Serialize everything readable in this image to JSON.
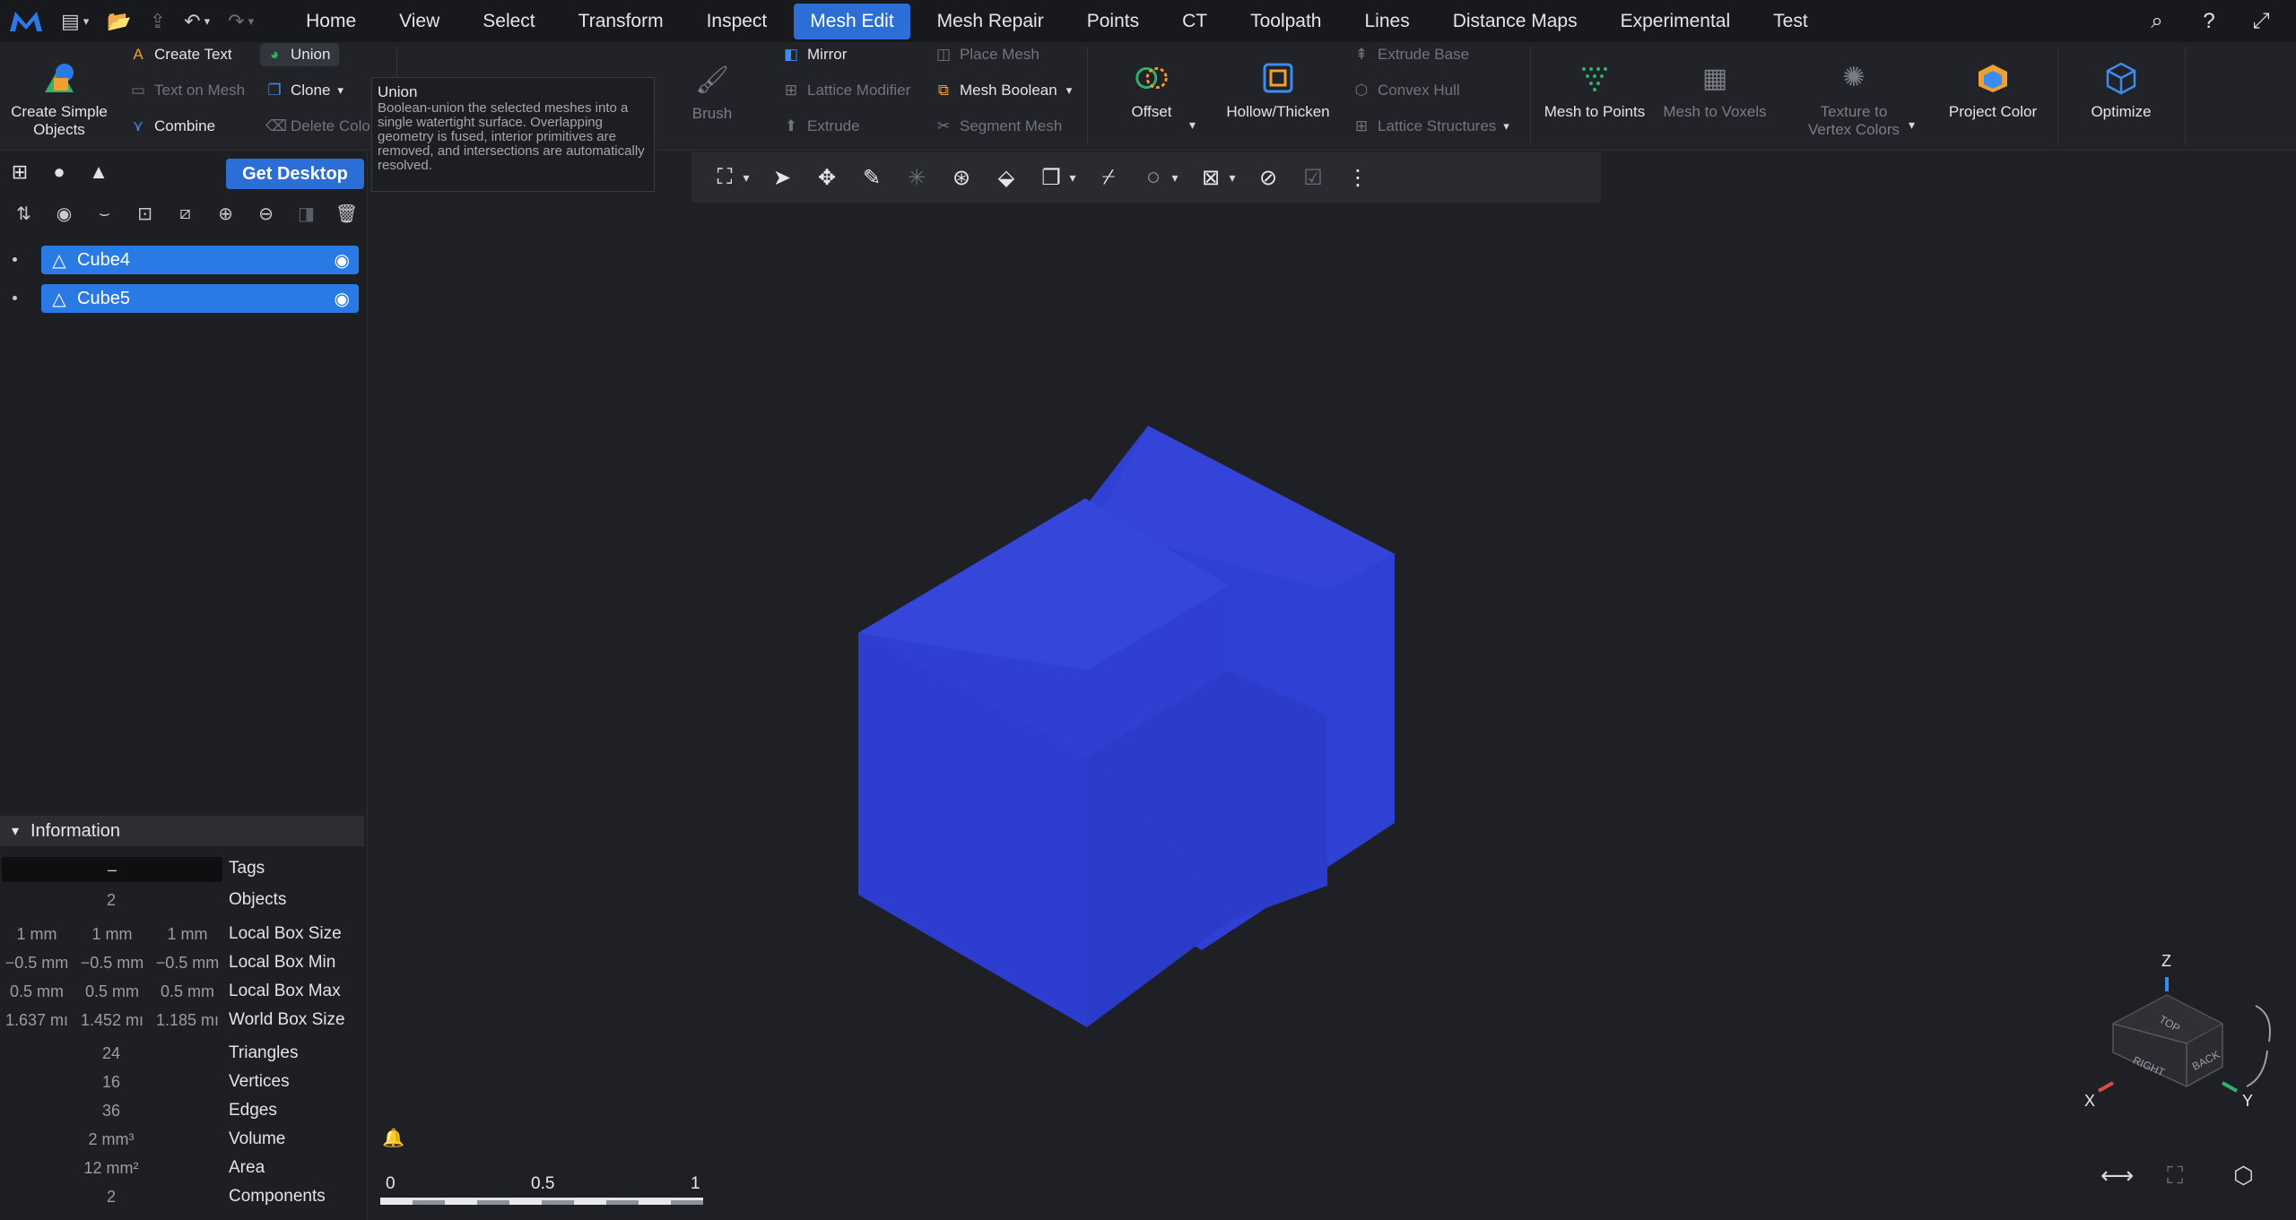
{
  "menubar": {
    "tabs": [
      "Home",
      "View",
      "Select",
      "Transform",
      "Inspect",
      "Mesh Edit",
      "Mesh Repair",
      "Points",
      "CT",
      "Toolpath",
      "Lines",
      "Distance Maps",
      "Experimental",
      "Test"
    ],
    "active_tab": "Mesh Edit"
  },
  "ribbon": {
    "create_simple_objects": "Create Simple Objects",
    "create_text": "Create Text",
    "union": "Union",
    "text_on_mesh": "Text on Mesh",
    "clone": "Clone",
    "combine": "Combine",
    "delete_color": "Delete Colo",
    "brush": "Brush",
    "mirror": "Mirror",
    "lattice_modifier": "Lattice Modifier",
    "extrude": "Extrude",
    "place_mesh": "Place Mesh",
    "mesh_boolean": "Mesh Boolean",
    "segment_mesh": "Segment Mesh",
    "offset": "Offset",
    "hollow_thicken": "Hollow/Thicken",
    "extrude_base": "Extrude Base",
    "convex_hull": "Convex Hull",
    "lattice_structures": "Lattice Structures",
    "mesh_to_points": "Mesh to Points",
    "mesh_to_voxels": "Mesh to Voxels",
    "texture_to_vertex_colors": "Texture to Vertex Colors",
    "project_color": "Project Color",
    "optimize": "Optimize"
  },
  "tooltip": {
    "title": "Union",
    "description": "Boolean-union the selected meshes into a single watertight surface. Overlapping geometry is fused, interior primitives are removed, and intersections are automatically resolved."
  },
  "left_panel": {
    "get_desktop": "Get Desktop",
    "objects": [
      {
        "name": "Cube4"
      },
      {
        "name": "Cube5"
      }
    ],
    "information_title": "Information",
    "info": {
      "tags": {
        "value": "–",
        "label": "Tags"
      },
      "objects": {
        "value": "2",
        "label": "Objects"
      },
      "local_box_size": {
        "values": [
          "1 mm",
          "1 mm",
          "1 mm"
        ],
        "label": "Local Box Size"
      },
      "local_box_min": {
        "values": [
          "−0.5 mm",
          "−0.5 mm",
          "−0.5 mm"
        ],
        "label": "Local Box Min"
      },
      "local_box_max": {
        "values": [
          "0.5 mm",
          "0.5 mm",
          "0.5 mm"
        ],
        "label": "Local Box Max"
      },
      "world_box_size": {
        "values": [
          "1.637 mı",
          "1.452 mı",
          "1.185 mı"
        ],
        "label": "World Box Size"
      },
      "triangles": {
        "value": "24",
        "label": "Triangles"
      },
      "vertices": {
        "value": "16",
        "label": "Vertices"
      },
      "edges": {
        "value": "36",
        "label": "Edges"
      },
      "volume": {
        "value": "2 mm³",
        "label": "Volume"
      },
      "area": {
        "value": "12 mm²",
        "label": "Area"
      },
      "components": {
        "value": "2",
        "label": "Components"
      }
    }
  },
  "viewport": {
    "scale_labels": [
      "0",
      "0.5",
      "1"
    ],
    "axis_labels": {
      "z": "Z",
      "x": "X",
      "y": "Y"
    },
    "view_cube": {
      "top": "TOP",
      "right": "RIGHT",
      "back": "BACK"
    },
    "mesh_color": "#3040d8"
  },
  "colors": {
    "accent": "#2b6fd6",
    "selected_item": "#2a7ae6",
    "background": "#1f2025"
  }
}
